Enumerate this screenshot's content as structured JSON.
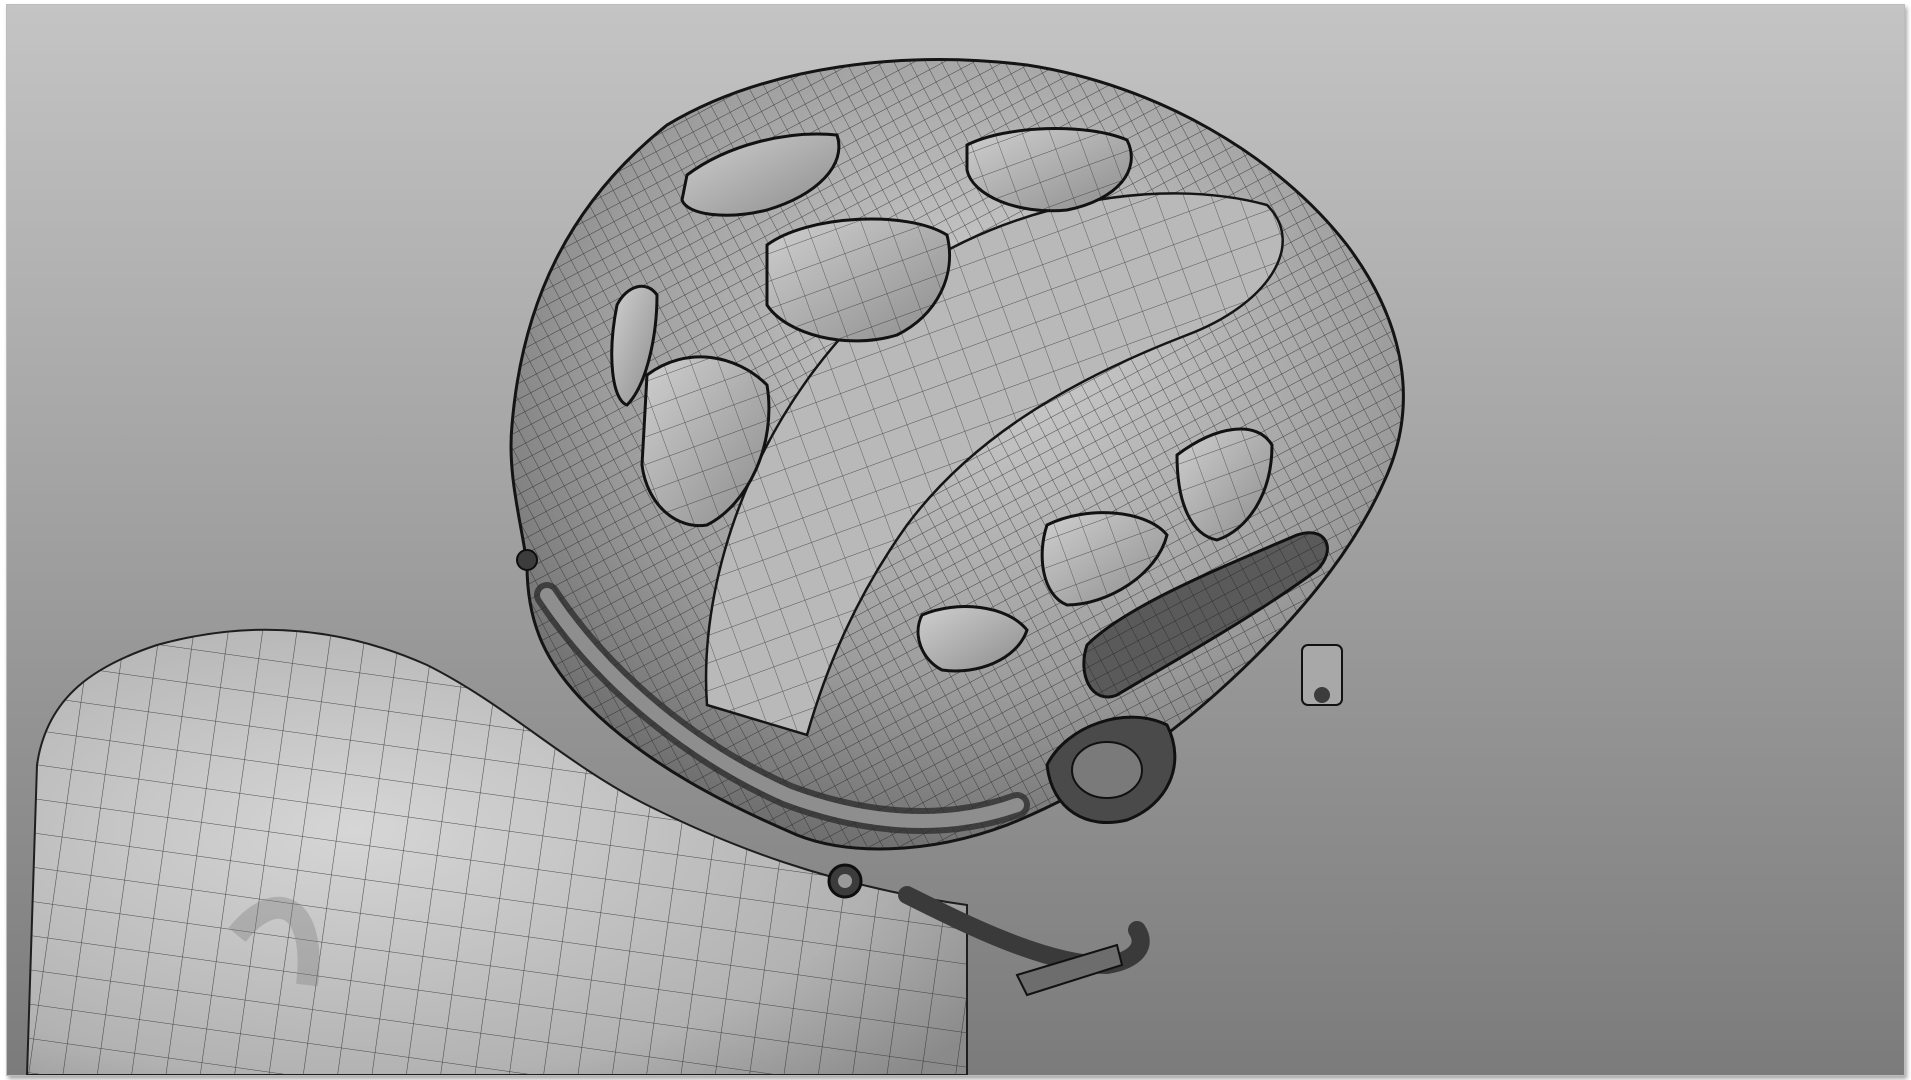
{
  "viewport": {
    "background_top": "#c4c4c4",
    "background_bottom": "#7b7b7b",
    "frame_border": "#bdbdbd"
  },
  "scene": {
    "subject_icon": "wireframe-helmet-on-head-icon",
    "mesh_surface": "#a9a9a9",
    "mesh_highlight": "#d4d4d4",
    "mesh_shadow": "#6a6a6a",
    "mesh_line": "#1e1e1e",
    "neck_surface": "#bcbcbc"
  }
}
